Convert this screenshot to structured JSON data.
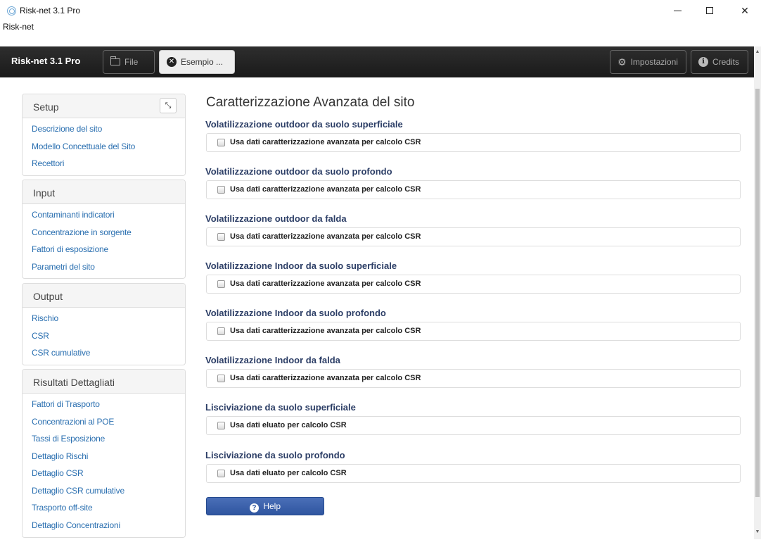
{
  "window": {
    "title": "Risk-net 3.1 Pro",
    "menu": "Risk-net",
    "min_glyph": "",
    "max_glyph": "",
    "close_glyph": "✕"
  },
  "toolbar": {
    "brand": "Risk-net 3.1 Pro",
    "file_label": "File",
    "esempio_label": "Esempio ...",
    "impostazioni_label": "Impostazioni",
    "credits_label": "Credits"
  },
  "sidebar": {
    "collapse_glyph": "⤡",
    "panels": [
      {
        "title": "Setup",
        "items": [
          "Descrizione del sito",
          "Modello Concettuale del Sito",
          "Recettori"
        ]
      },
      {
        "title": "Input",
        "items": [
          "Contaminanti indicatori",
          "Concentrazione in sorgente",
          "Fattori di esposizione",
          "Parametri del sito"
        ]
      },
      {
        "title": "Output",
        "items": [
          "Rischio",
          "CSR",
          "CSR cumulative"
        ]
      },
      {
        "title": "Risultati Dettagliati",
        "items": [
          "Fattori di Trasporto",
          "Concentrazioni al POE",
          "Tassi di Esposizione",
          "Dettaglio Rischi",
          "Dettaglio CSR",
          "Dettaglio CSR cumulative",
          "Trasporto off-site",
          "Dettaglio Concentrazioni"
        ]
      }
    ]
  },
  "main": {
    "title": "Caratterizzazione Avanzata del sito",
    "sections": [
      {
        "title": "Volatilizzazione outdoor da suolo superficiale",
        "checkbox": "Usa dati caratterizzazione avanzata per calcolo CSR"
      },
      {
        "title": "Volatilizzazione outdoor da suolo profondo",
        "checkbox": "Usa dati caratterizzazione avanzata per calcolo CSR"
      },
      {
        "title": "Volatilizzazione outdoor da falda",
        "checkbox": "Usa dati caratterizzazione avanzata per calcolo CSR"
      },
      {
        "title": "Volatilizzazione Indoor da suolo superficiale",
        "checkbox": "Usa dati caratterizzazione avanzata per calcolo CSR"
      },
      {
        "title": "Volatilizzazione Indoor da suolo profondo",
        "checkbox": "Usa dati caratterizzazione avanzata per calcolo CSR"
      },
      {
        "title": "Volatilizzazione Indoor da falda",
        "checkbox": "Usa dati caratterizzazione avanzata per calcolo CSR"
      },
      {
        "title": "Lisciviazione da suolo superficiale",
        "checkbox": "Usa dati eluato per calcolo CSR"
      },
      {
        "title": "Lisciviazione da suolo profondo",
        "checkbox": "Usa dati eluato per calcolo CSR"
      }
    ],
    "help_label": "Help"
  }
}
